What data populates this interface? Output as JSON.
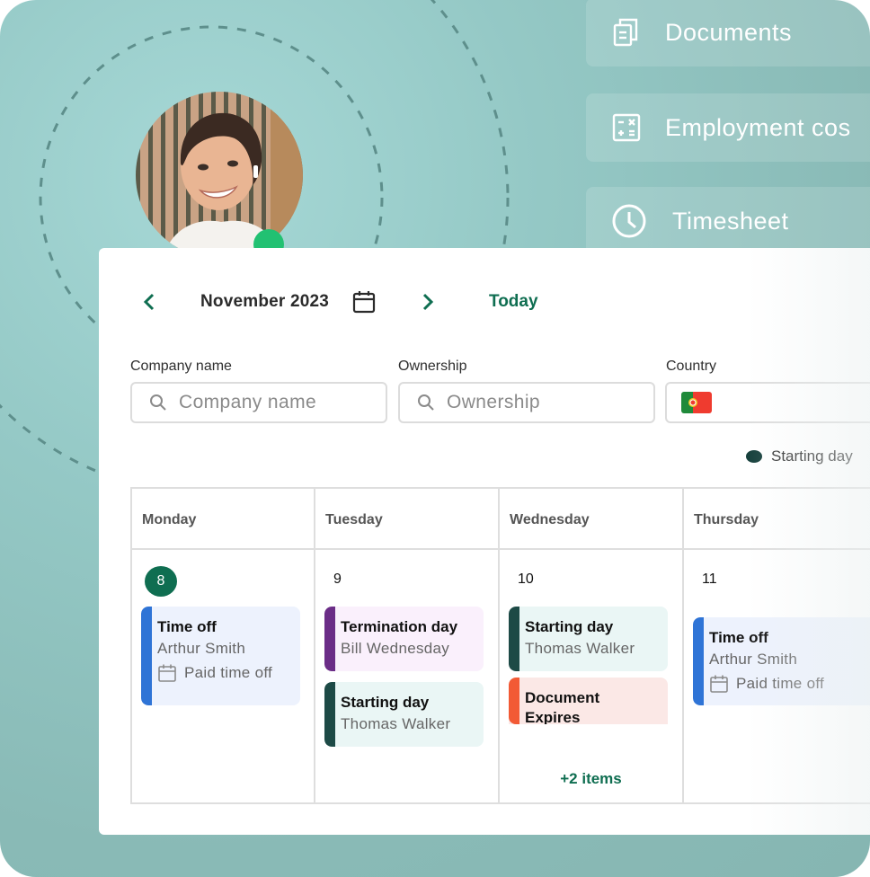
{
  "side_menu": {
    "items": [
      {
        "label": "Documents",
        "icon": "documents-icon"
      },
      {
        "label": "Employment cos",
        "icon": "calculator-icon"
      },
      {
        "label": "Timesheet",
        "icon": "clock-icon"
      }
    ]
  },
  "profile": {
    "avatar": "woman-portrait-photo",
    "status": "online"
  },
  "calendar": {
    "month_label": "November 2023",
    "today_label": "Today"
  },
  "filters": {
    "company": {
      "label": "Company name",
      "placeholder": "Company name",
      "value": ""
    },
    "ownership": {
      "label": "Ownership",
      "placeholder": "Ownership",
      "value": ""
    },
    "country": {
      "label": "Country",
      "value": "Portugal",
      "flag": "portugal-flag"
    }
  },
  "legend": {
    "label": "Starting day",
    "color": "#153f3b"
  },
  "colors": {
    "accent": "#0f6e51",
    "time_off": "#2f74d6",
    "termination": "#6b2d87",
    "starting": "#1d4a46",
    "document": "#f25a35"
  },
  "week": {
    "days": [
      {
        "name": "Monday",
        "date": "8",
        "is_today": true,
        "events": [
          {
            "title": "Time off",
            "person": "Arthur Smith",
            "meta": "Paid time off"
          }
        ]
      },
      {
        "name": "Tuesday",
        "date": "9",
        "is_today": false,
        "events": [
          {
            "title": "Termination day",
            "person": "Bill Wednesday"
          },
          {
            "title": "Starting day",
            "person": "Thomas Walker"
          }
        ]
      },
      {
        "name": "Wednesday",
        "date": "10",
        "is_today": false,
        "events": [
          {
            "title": "Starting day",
            "person": "Thomas Walker"
          },
          {
            "title": "Document Expires"
          }
        ],
        "more_label": "+2 items"
      },
      {
        "name": "Thursday",
        "date": "11",
        "is_today": false,
        "events": [
          {
            "title": "Time off",
            "person": "Arthur Smith",
            "meta": "Paid time off"
          }
        ]
      }
    ]
  }
}
